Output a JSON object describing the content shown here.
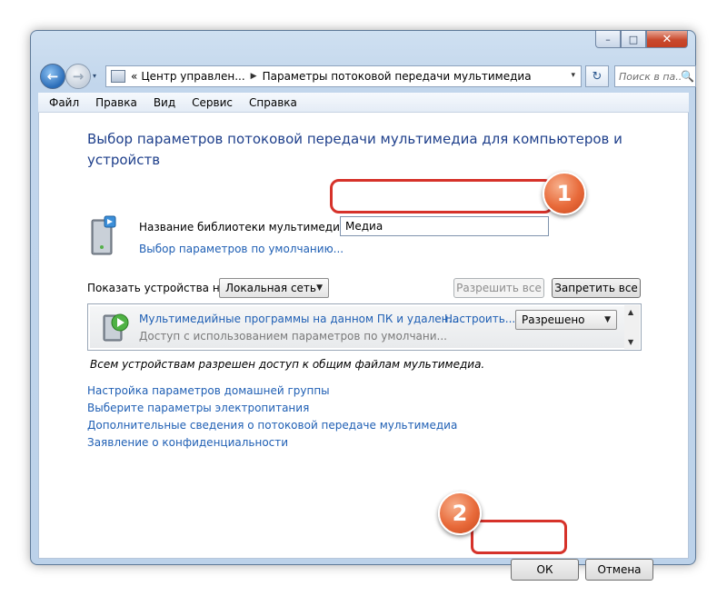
{
  "window": {
    "controls": {
      "minimize": "–",
      "maximize": "□",
      "close": "✕"
    }
  },
  "navigation": {
    "back_icon": "←",
    "forward_icon": "→",
    "history_dropdown": "▾",
    "breadcrumb_prefix": "«",
    "breadcrumb": [
      "Центр управлен...",
      "Параметры потоковой передачи мультимедиа"
    ],
    "breadcrumb_separator": "▶",
    "address_dropdown": "▾",
    "refresh_icon": "↻",
    "search_placeholder": "Поиск в па...",
    "search_icon": "🔍"
  },
  "menubar": {
    "items": [
      "Файл",
      "Правка",
      "Вид",
      "Сервис",
      "Справка"
    ]
  },
  "content": {
    "heading": "Выбор параметров потоковой передачи мультимедиа для компьютеров и устройств",
    "library_label": "Название библиотеки мультимедиа:",
    "library_name": "Медиа",
    "default_settings_link": "Выбор параметров по умолчанию...",
    "show_devices_label": "Показать устройства на:",
    "network_select": "Локальная сеть",
    "allow_all_button": "Разрешить все",
    "deny_all_button": "Запретить все",
    "device": {
      "name": "Мультимедийные программы на данном ПК и удален...",
      "description": "Доступ с использованием параметров по умолчани...",
      "configure_link": "Настроить...",
      "access_select": "Разрешено"
    },
    "note": "Всем устройствам разрешен доступ к общим файлам мультимедиа.",
    "links": [
      "Настройка параметров домашней группы",
      "Выберите параметры электропитания",
      "Дополнительные сведения о потоковой передаче мультимедиа",
      "Заявление о конфиденциальности"
    ],
    "ok_button": "ОК",
    "cancel_button": "Отмена"
  },
  "annotations": {
    "callout_1": "1",
    "callout_2": "2",
    "highlight_color": "#d6322a",
    "callout_color": "#e86a3a"
  }
}
